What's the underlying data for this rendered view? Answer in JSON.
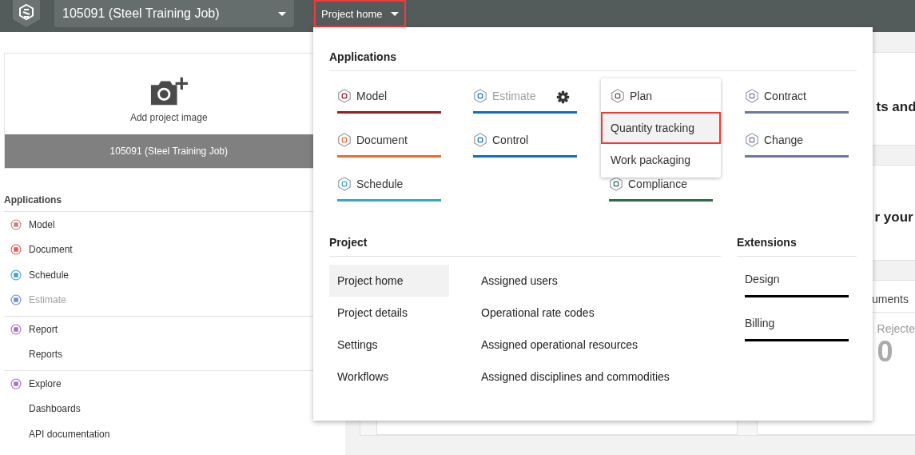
{
  "top_bar": {
    "project_selector": {
      "value": "105091 (Steel Training Job)"
    },
    "menu_button": {
      "label": "Project home",
      "highlighted": true
    }
  },
  "project_card": {
    "add_image_label": "Add project image",
    "project_name": "105091 (Steel Training Job)"
  },
  "sidebar": {
    "heading": "Applications",
    "groups": [
      {
        "items": [
          {
            "label": "Model",
            "kind": "app",
            "color": "#c9867f",
            "disabled": false
          },
          {
            "label": "Document",
            "kind": "app",
            "color": "#ee5a4f",
            "disabled": false
          },
          {
            "label": "Schedule",
            "kind": "app",
            "color": "#3fa6c6",
            "disabled": false
          },
          {
            "label": "Estimate",
            "kind": "app",
            "color": "#6d8fd6",
            "disabled": true
          }
        ]
      },
      {
        "items": [
          {
            "label": "Report",
            "kind": "app",
            "color": "#a672c6",
            "disabled": false
          },
          {
            "label": "Reports",
            "kind": "link",
            "disabled": false
          }
        ]
      },
      {
        "items": [
          {
            "label": "Explore",
            "kind": "app",
            "color": "#a672c6",
            "disabled": false
          },
          {
            "label": "Dashboards",
            "kind": "link",
            "disabled": false
          },
          {
            "label": "API documentation",
            "kind": "link",
            "disabled": false
          }
        ]
      }
    ]
  },
  "background": {
    "section_title_1": "ts and",
    "section_title_2": "r your",
    "tab": "uments",
    "stat_label": "Rejecte",
    "stat_value": "0"
  },
  "dropdown": {
    "applications": {
      "heading": "Applications",
      "columns": [
        {
          "tiles": [
            {
              "label": "Model",
              "color": "#9b1c24",
              "disabled": false,
              "settings": false
            },
            {
              "label": "Document",
              "color": "#f26b2a",
              "disabled": false,
              "settings": false
            },
            {
              "label": "Schedule",
              "color": "#2eaac6",
              "disabled": false,
              "settings": false
            }
          ]
        },
        {
          "tiles": [
            {
              "label": "Estimate",
              "color": "#0a72c4",
              "disabled": true,
              "settings": true
            },
            {
              "label": "Control",
              "color": "#0a72c4",
              "disabled": false,
              "settings": false
            }
          ]
        },
        {
          "submenu": [
            {
              "label": "Plan",
              "kind": "app",
              "highlighted": false
            },
            {
              "label": "Quantity tracking",
              "kind": "link",
              "highlighted": true
            },
            {
              "label": "Work packaging",
              "kind": "link",
              "highlighted": false
            }
          ],
          "tiles": [
            {
              "label": "Compliance",
              "color": "#2a6b4a",
              "disabled": false,
              "settings": false
            }
          ]
        },
        {
          "tiles": [
            {
              "label": "Contract",
              "color": "#6b77a0",
              "disabled": false,
              "settings": false
            },
            {
              "label": "Change",
              "color": "#6b77a0",
              "disabled": false,
              "settings": false
            }
          ]
        }
      ]
    },
    "project": {
      "heading": "Project",
      "columns": [
        [
          {
            "label": "Project home",
            "selected": true
          },
          {
            "label": "Project details",
            "selected": false
          },
          {
            "label": "Settings",
            "selected": false
          },
          {
            "label": "Workflows",
            "selected": false
          }
        ],
        [
          {
            "label": "Assigned users",
            "selected": false
          },
          {
            "label": "Operational rate codes",
            "selected": false
          },
          {
            "label": "Assigned operational resources",
            "selected": false
          },
          {
            "label": "Assigned disciplines and commodities",
            "selected": false
          }
        ]
      ]
    },
    "extensions": {
      "heading": "Extensions",
      "items": [
        {
          "label": "Design"
        },
        {
          "label": "Billing"
        }
      ]
    }
  }
}
